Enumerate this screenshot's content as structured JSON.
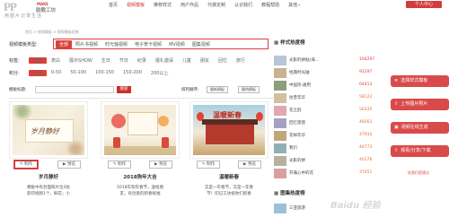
{
  "header": {
    "logo_mark": "PP",
    "logo_make": "MAKE",
    "logo_cn": "韵歌工坊",
    "slogan": "用图片记录生活",
    "nav": [
      "首页",
      "视频模板",
      "推荐样式",
      "用户作品",
      "代做定制",
      "认识我们",
      "教程帮助",
      "其他"
    ],
    "nav_active_index": 1,
    "center_button": "个人中心"
  },
  "breadcrumb": "首页 > 视频模板 > 视频模板定制",
  "categories": {
    "label": "视频模板类型:",
    "items": [
      "全部",
      "照片书视频",
      "时光轴视频",
      "电子贺卡视频",
      "MV视频",
      "图集视频"
    ],
    "active_index": 0
  },
  "filters": [
    {
      "label": "标签:",
      "items": [
        "全部",
        "表白",
        "展示SHOW",
        "生日",
        "节日",
        "纪录",
        "婚礼邀请",
        "儿童",
        "朋友",
        "回忆",
        "旅行"
      ]
    },
    {
      "label": "积分:",
      "items": [
        "全部",
        "0-50",
        "50-100",
        "100-150",
        "150-200",
        "200以上"
      ]
    }
  ],
  "search": {
    "label": "模板标题:",
    "placeholder": "",
    "button": "搜索",
    "sort_label": "排列顺序:",
    "sort_latest": "最新模板",
    "sort_popular": "最热模板"
  },
  "cards": [
    {
      "title": "岁月静好",
      "make": "制作",
      "preview": "预览",
      "desc_line1": "模板中有封面照片位3张",
      "desc_line2": "影印视频1个，鲜花；小",
      "img_text": "岁月静好"
    },
    {
      "title": "2018狗年大吉",
      "make": "制作",
      "preview": "预览",
      "desc_line1": "2018年狗年春节，送给朋",
      "desc_line2": "友，有创意的新春祝福",
      "img_text": ""
    },
    {
      "title": "温暖新春",
      "make": "制作",
      "preview": "预览",
      "desc_line1": "又是一年春节，又是一年春",
      "desc_line2": "节！印记工坊祝你们新春",
      "img_text": "温暖新春"
    }
  ],
  "sidebar": {
    "hot_title": "样式热度榜",
    "hot": [
      {
        "name": "光影的拼贴(海...",
        "count": "104297"
      },
      {
        "name": "经典时光轴",
        "count": "92297"
      },
      {
        "name": "中国风·通用",
        "count": "64413"
      },
      {
        "name": "往昔年华",
        "count": "58122"
      },
      {
        "name": "花之韵",
        "count": "56335"
      },
      {
        "name": "回忆悠悠",
        "count": "49261"
      },
      {
        "name": "花样年华",
        "count": "47932"
      },
      {
        "name": "我们",
        "count": "44773"
      },
      {
        "name": "光影的拼",
        "count": "40176"
      },
      {
        "name": "开满心中的花",
        "count": "37451"
      }
    ],
    "album_title": "图集热度榜",
    "album_first": "三亚旅游"
  },
  "floating": [
    {
      "label": "选择样式模板",
      "icon": "≡"
    },
    {
      "label": "上传图片照片",
      "icon": "⇪"
    },
    {
      "label": "视频在线生成",
      "icon": "▣"
    },
    {
      "label": "观看/分享/下载",
      "icon": "⇧"
    }
  ],
  "feedback": "给我们提建议",
  "watermark": "Baidu 经验",
  "colors": {
    "accent": "#d94a4a",
    "brand_red": "#c9302c"
  }
}
